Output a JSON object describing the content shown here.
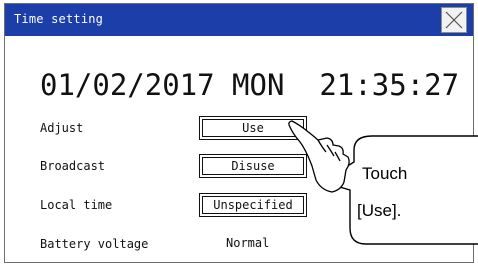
{
  "window": {
    "title": "Time setting"
  },
  "datetime": {
    "display": "01/02/2017 MON  21:35:27"
  },
  "settings": {
    "adjust": {
      "label": "Adjust",
      "value": "Use"
    },
    "broadcast": {
      "label": "Broadcast",
      "value": "Disuse"
    },
    "local_time": {
      "label": "Local time",
      "value": "Unspecified"
    },
    "battery_voltage": {
      "label": "Battery voltage",
      "value": "Normal"
    }
  },
  "callout": {
    "line1": "Touch",
    "line2": "[Use]."
  },
  "colors": {
    "titlebar": "#1b3ea8",
    "title_text": "#ffffff",
    "border": "#111111"
  },
  "icons": {
    "close": "close-x-icon",
    "hand": "pointing-hand-icon"
  }
}
